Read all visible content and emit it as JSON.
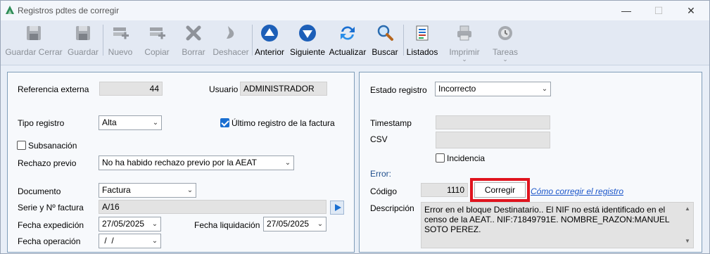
{
  "window": {
    "title": "Registros pdtes de corregir"
  },
  "toolbar": [
    {
      "label": "Guardar Cerrar",
      "icon": "floppy-disk-close-icon",
      "enabled": false
    },
    {
      "label": "Guardar",
      "icon": "floppy-disk-icon",
      "enabled": false
    },
    {
      "label": "Nuevo",
      "icon": "new-record-icon",
      "enabled": false
    },
    {
      "label": "Copiar",
      "icon": "copy-record-icon",
      "enabled": false
    },
    {
      "label": "Borrar",
      "icon": "delete-x-icon",
      "enabled": false
    },
    {
      "label": "Deshacer",
      "icon": "undo-icon",
      "enabled": false
    },
    {
      "label": "Anterior",
      "icon": "arrow-up-circle-icon",
      "enabled": true
    },
    {
      "label": "Siguiente",
      "icon": "arrow-down-circle-icon",
      "enabled": true
    },
    {
      "label": "Actualizar",
      "icon": "refresh-icon",
      "enabled": true
    },
    {
      "label": "Buscar",
      "icon": "magnifier-icon",
      "enabled": true
    },
    {
      "label": "Listados",
      "icon": "report-list-icon",
      "enabled": true
    },
    {
      "label": "Imprimir",
      "icon": "printer-icon",
      "enabled": false,
      "dropdown": true
    },
    {
      "label": "Tareas",
      "icon": "gear-tasks-icon",
      "enabled": false,
      "dropdown": true
    }
  ],
  "left": {
    "referencia_externa": {
      "label": "Referencia externa",
      "value": "44"
    },
    "usuario": {
      "label": "Usuario",
      "value": "ADMINISTRADOR"
    },
    "tipo_registro": {
      "label": "Tipo registro",
      "value": "Alta"
    },
    "ultimo_registro": {
      "label": "Último registro de la factura",
      "checked": true
    },
    "subsanacion": {
      "label": "Subsanación",
      "checked": false
    },
    "rechazo_previo": {
      "label": "Rechazo previo",
      "value": "No ha habido rechazo previo por la AEAT"
    },
    "documento": {
      "label": "Documento",
      "value": "Factura"
    },
    "serie_factura": {
      "label": "Serie y Nº factura",
      "value": "A/16"
    },
    "fecha_expedicion": {
      "label": "Fecha expedición",
      "value": "27/05/2025"
    },
    "fecha_liquidacion": {
      "label": "Fecha liquidación",
      "value": "27/05/2025"
    },
    "fecha_operacion": {
      "label": "Fecha operación",
      "value": " /  /"
    }
  },
  "right": {
    "estado_registro": {
      "label": "Estado registro",
      "value": "Incorrecto"
    },
    "timestamp": {
      "label": "Timestamp",
      "value": ""
    },
    "csv": {
      "label": "CSV",
      "value": ""
    },
    "incidencia": {
      "label": "Incidencia",
      "checked": false
    },
    "error_heading": "Error:",
    "codigo": {
      "label": "Código",
      "value": "1110"
    },
    "corregir_button": "Corregir",
    "como_corregir_link": "Cómo corregir el registro",
    "descripcion": {
      "label": "Descripción",
      "value": "Error en el bloque Destinatario.. El NIF no está identificado en el censo de la AEAT.. NIF:71849791E. NOMBRE_RAZON:MANUEL SOTO PEREZ."
    }
  },
  "colors": {
    "accent": "#1a6fd1",
    "highlight_box": "#e0141e",
    "link": "#1a55c9"
  }
}
